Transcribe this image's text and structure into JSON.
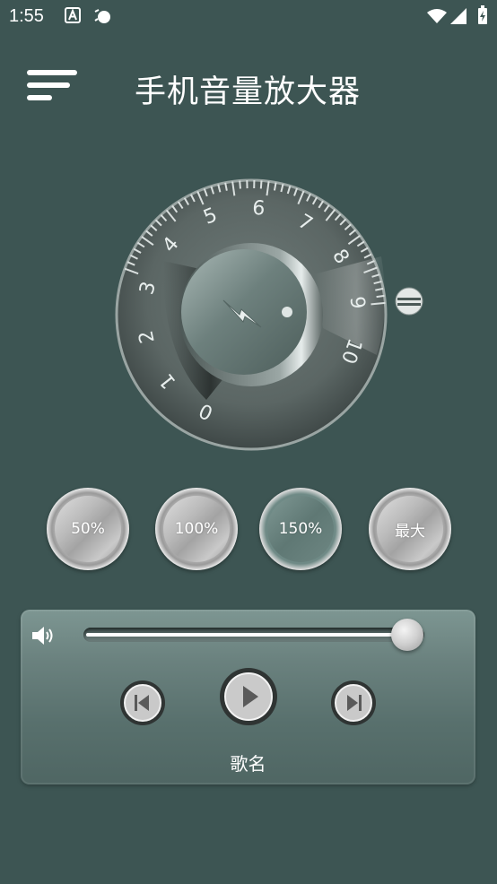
{
  "status_bar": {
    "time": "1:55",
    "icons": [
      "a-notification-icon",
      "alarm-icon",
      "wifi-icon",
      "signal-icon",
      "battery-charging-icon"
    ]
  },
  "header": {
    "menu_icon": "menu-icon",
    "title": "手机音量放大器"
  },
  "dial": {
    "scale_labels": [
      "0",
      "1",
      "2",
      "3",
      "4",
      "5",
      "6",
      "7",
      "8",
      "9",
      "10"
    ],
    "center_icon": "lightning-icon",
    "side_knob_icon": "equals-icon"
  },
  "presets": [
    {
      "label": "50%"
    },
    {
      "label": "100%"
    },
    {
      "label": "150%",
      "active": true
    },
    {
      "label": "最大"
    }
  ],
  "player": {
    "volume_icon": "speaker-icon",
    "volume_level": 0.95,
    "prev_icon": "previous-icon",
    "play_icon": "play-icon",
    "next_icon": "next-icon",
    "song_name": "歌名"
  },
  "colors": {
    "background": "#3d5553",
    "player_panel": "#6a817e",
    "text": "#ffffff"
  }
}
